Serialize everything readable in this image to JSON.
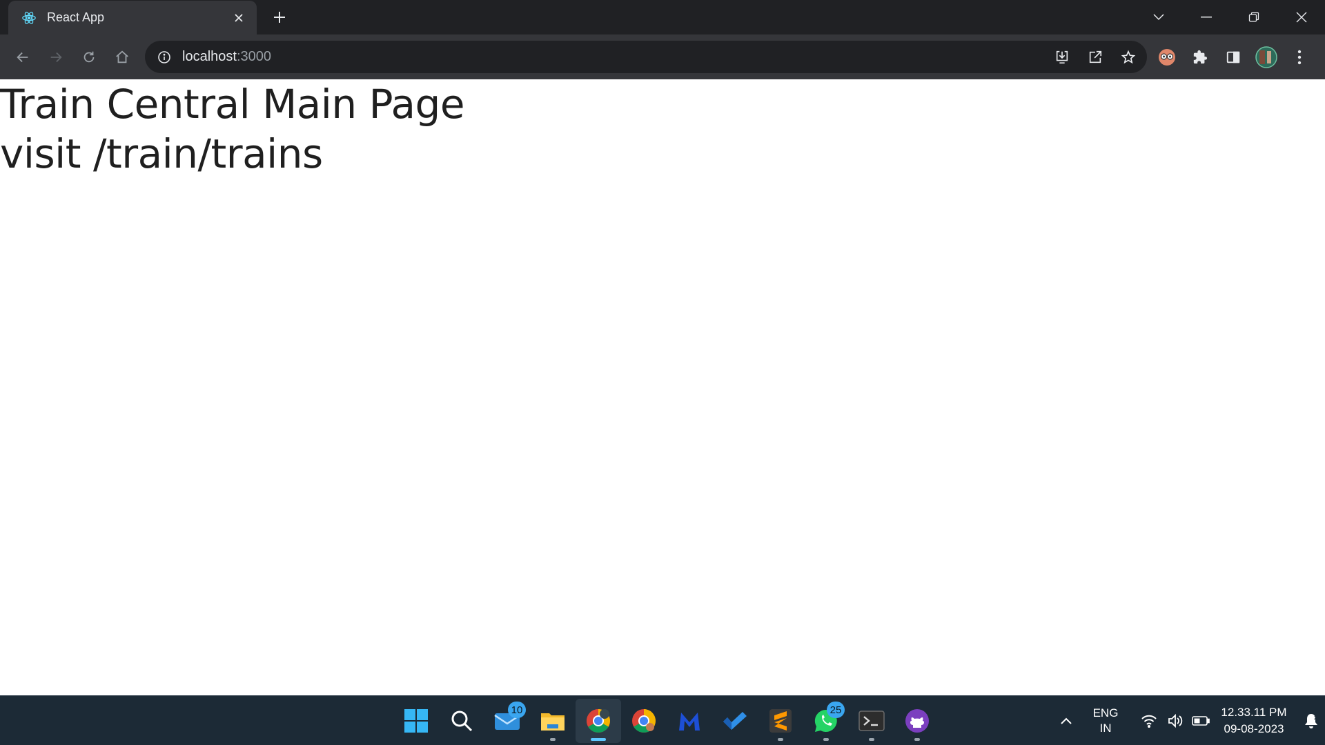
{
  "browser": {
    "tab": {
      "title": "React App",
      "favicon_icon": "react-icon"
    },
    "address": {
      "host": "localhost",
      "port": ":3000"
    }
  },
  "page": {
    "line1": "Train Central Main Page",
    "line2": "visit /train/trains"
  },
  "taskbar": {
    "apps": [
      {
        "name": "start",
        "icon": "windows-icon"
      },
      {
        "name": "search",
        "icon": "search-icon"
      },
      {
        "name": "mail",
        "icon": "mail-icon",
        "badge": "10"
      },
      {
        "name": "file-explorer",
        "icon": "folder-icon"
      },
      {
        "name": "chrome",
        "icon": "chrome-icon",
        "active": true
      },
      {
        "name": "chrome-2",
        "icon": "chrome-icon"
      },
      {
        "name": "malwarebytes",
        "icon": "malwarebytes-icon"
      },
      {
        "name": "todo",
        "icon": "checkmark-icon"
      },
      {
        "name": "sublime",
        "icon": "sublime-icon"
      },
      {
        "name": "whatsapp",
        "icon": "whatsapp-icon",
        "badge": "25"
      },
      {
        "name": "terminal",
        "icon": "terminal-icon"
      },
      {
        "name": "github",
        "icon": "github-icon"
      }
    ],
    "language": {
      "line1": "ENG",
      "line2": "IN"
    },
    "clock": {
      "time": "12.33.11 PM",
      "date": "09-08-2023"
    }
  },
  "colors": {
    "titlebar": "#202124",
    "toolbar": "#35363a",
    "taskbar": "#1c2a36",
    "accent": "#5ec8ff"
  }
}
